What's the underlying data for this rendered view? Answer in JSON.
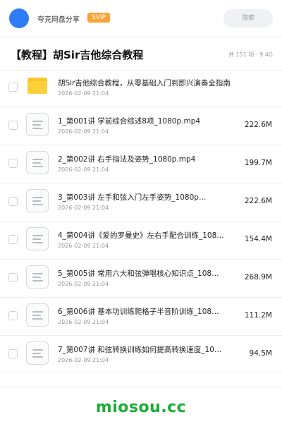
{
  "header": {
    "brand": "夸克网盘分享",
    "badge": "SVIP",
    "search_label": "搜索"
  },
  "share": {
    "title": "【教程】胡Sir吉他综合教程",
    "meta": "共 151 项 · 9.4G"
  },
  "items": [
    {
      "name": "胡Sir吉他综合教程，从零基础入门到即兴演奏全指南",
      "date": "2026-02-09 21:04",
      "size": "",
      "type": "folder"
    },
    {
      "name": "1_第001讲 学前综合综述8项_1080p.mp4",
      "date": "2026-02-09 21:04",
      "size": "222.6M",
      "type": "file"
    },
    {
      "name": "2_第002讲 右手指法及姿势_1080p.mp4",
      "date": "2026-02-09 21:04",
      "size": "199.7M",
      "type": "file"
    },
    {
      "name": "3_第003讲 左手和弦入门左手姿势_1080p…",
      "date": "2026-02-09 21:04",
      "size": "222.6M",
      "type": "file"
    },
    {
      "name": "4_第004讲《爱的罗曼史》左右手配合训练_108…",
      "date": "2026-02-09 21:04",
      "size": "154.4M",
      "type": "file"
    },
    {
      "name": "5_第005讲 常用六大和弦弹唱核心知识点_108…",
      "date": "2026-02-09 21:04",
      "size": "268.9M",
      "type": "file"
    },
    {
      "name": "6_第006讲 基本功训练爬格子半音阶训练_108…",
      "date": "2026-02-09 21:04",
      "size": "111.2M",
      "type": "file"
    },
    {
      "name": "7_第007讲 和弦转换训练如何提高转换速度_10…",
      "date": "2026-02-09 21:04",
      "size": "94.5M",
      "type": "file"
    }
  ],
  "footer": {
    "watermark": "miosou.cc"
  },
  "colors": {
    "avatar": "#2f7cf6",
    "badge": "#f7a53a",
    "folder": "#fbd03b",
    "watermark": "#1aad36"
  },
  "icons": {
    "folder": "folder-icon",
    "file": "video-file-icon"
  }
}
